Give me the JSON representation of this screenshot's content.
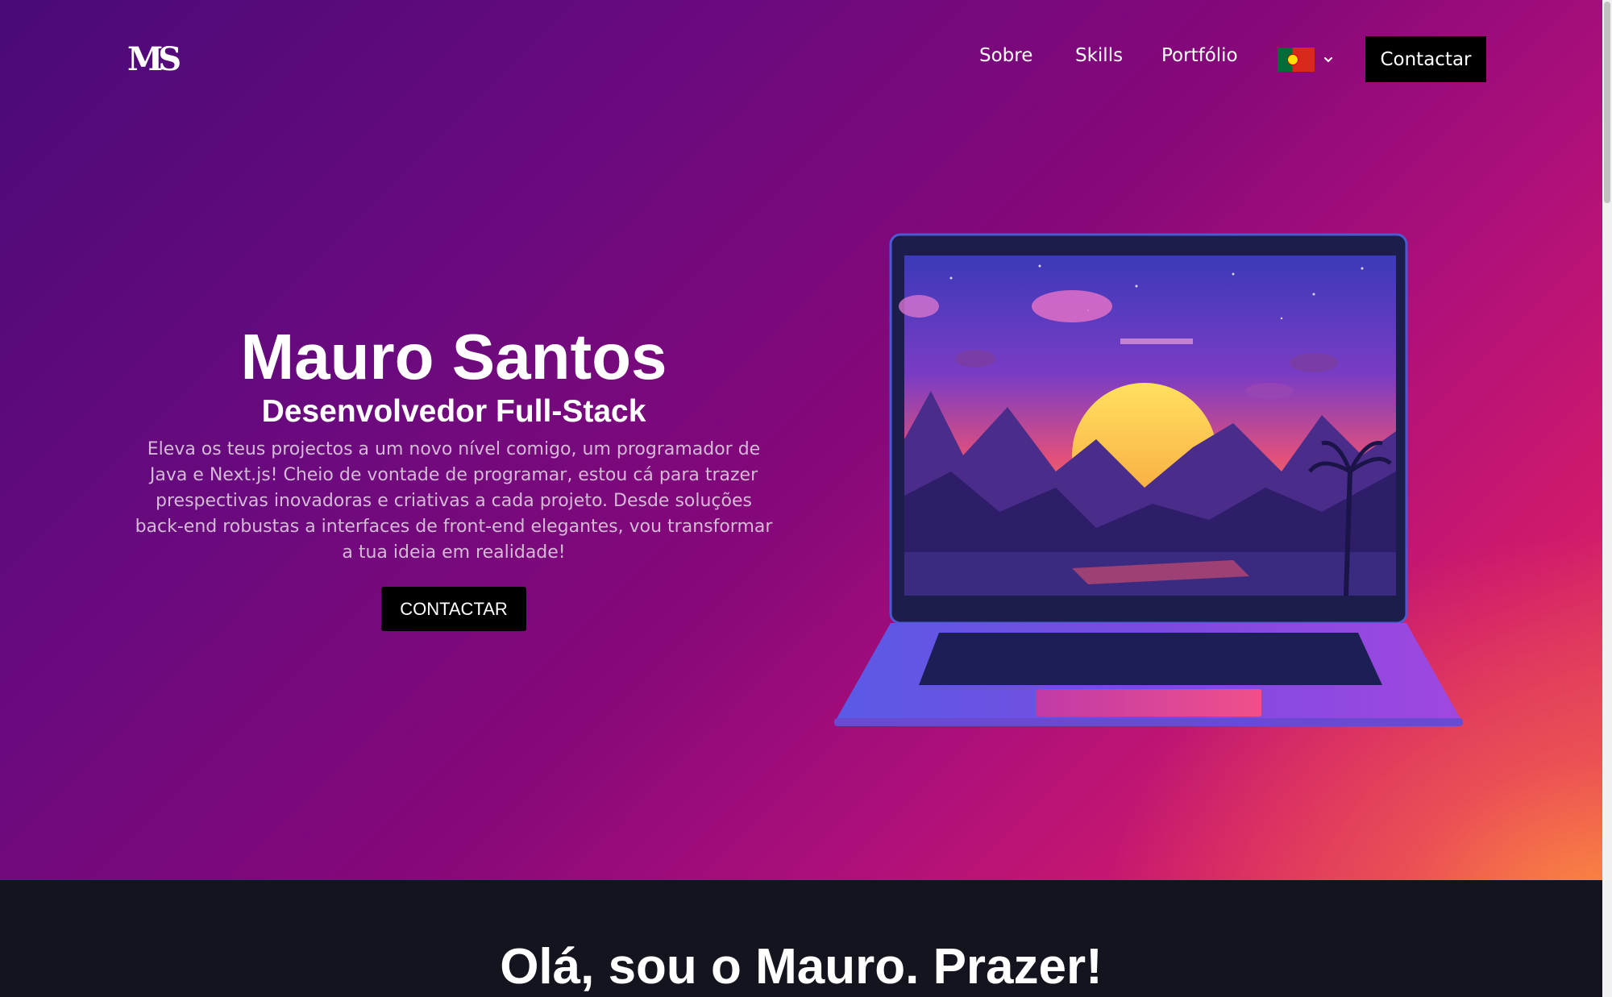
{
  "nav": {
    "logo": "MS",
    "links": [
      "Sobre",
      "Skills",
      "Portfólio"
    ],
    "language": {
      "current": "pt",
      "flag_colors": [
        "#046a38",
        "#da291c",
        "#ffe000"
      ]
    },
    "contact_label": "Contactar"
  },
  "hero": {
    "name": "Mauro Santos",
    "role": "Desenvolvedor Full-Stack",
    "description": "Eleva os teus projectos a um novo nível comigo, um programador de Java e Next.js! Cheio de vontade de programar, estou cá para trazer prespectivas inovadoras e criativas a cada projeto. Desde soluções back-end robustas a interfaces de front-end elegantes, vou transformar a tua ideia em realidade!",
    "cta_label": "CONTACTAR",
    "image": "laptop-sunset-illustration"
  },
  "about": {
    "title": "Olá, sou o Mauro. Prazer!"
  },
  "colors": {
    "hero_gradient_start": "#4a0a78",
    "hero_gradient_mid": "#b0107a",
    "hero_gradient_end": "#ff9a3c",
    "dark_section": "#14141f",
    "button_bg": "#000000",
    "description_text": "#d4b8d6"
  }
}
